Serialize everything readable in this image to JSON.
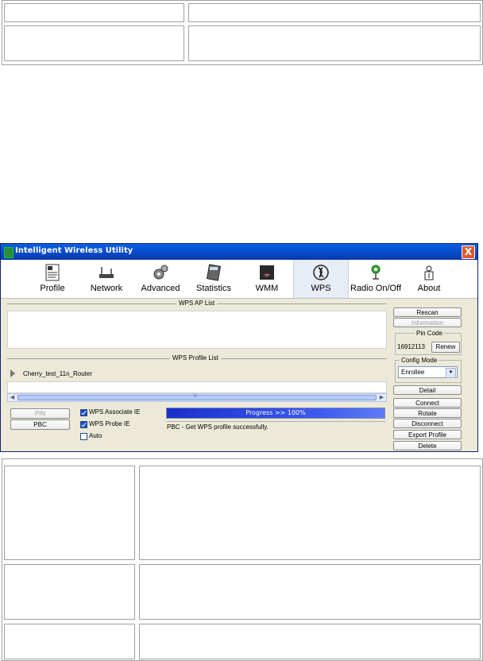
{
  "window": {
    "title": "Intelligent Wireless Utility",
    "close": "X"
  },
  "toolbar": {
    "items": [
      {
        "label": "Profile",
        "icon": "profile-icon"
      },
      {
        "label": "Network",
        "icon": "network-icon"
      },
      {
        "label": "Advanced",
        "icon": "advanced-icon"
      },
      {
        "label": "Statistics",
        "icon": "statistics-icon"
      },
      {
        "label": "WMM",
        "icon": "wmm-icon"
      },
      {
        "label": "WPS",
        "icon": "wps-icon",
        "active": true
      },
      {
        "label": "Radio On/Off",
        "icon": "radio-icon"
      },
      {
        "label": "About",
        "icon": "about-icon"
      }
    ]
  },
  "wps": {
    "ap_list_title": "WPS AP List",
    "profile_list_title": "WPS Profile List",
    "profile_item": "Cherry_test_11n_Router",
    "pin_button": "PIN",
    "pbc_button": "PBC",
    "assoc_ie": "WPS Associate IE",
    "probe_ie": "WPS Probe IE",
    "auto": "Auto",
    "progress_text": "Progress >> 100%",
    "progress": 1.0,
    "status_text": "PBC - Get WPS profile successfully.",
    "scroll_mid": "III"
  },
  "side": {
    "rescan": "Rescan",
    "information": "Information",
    "pin_code_label": "Pin Code",
    "pin_code": "16912113",
    "renew": "Renew",
    "config_mode_label": "Config Mode",
    "config_mode": "Enrollee",
    "detail": "Detail",
    "connect": "Connect",
    "rotate": "Rotate",
    "disconnect": "Disconnect",
    "export_profile": "Export Profile",
    "delete": "Delete"
  },
  "colors": {
    "title_bar": "#0849c6",
    "progress": "#2340d8",
    "window_bg": "#ece9d8"
  }
}
